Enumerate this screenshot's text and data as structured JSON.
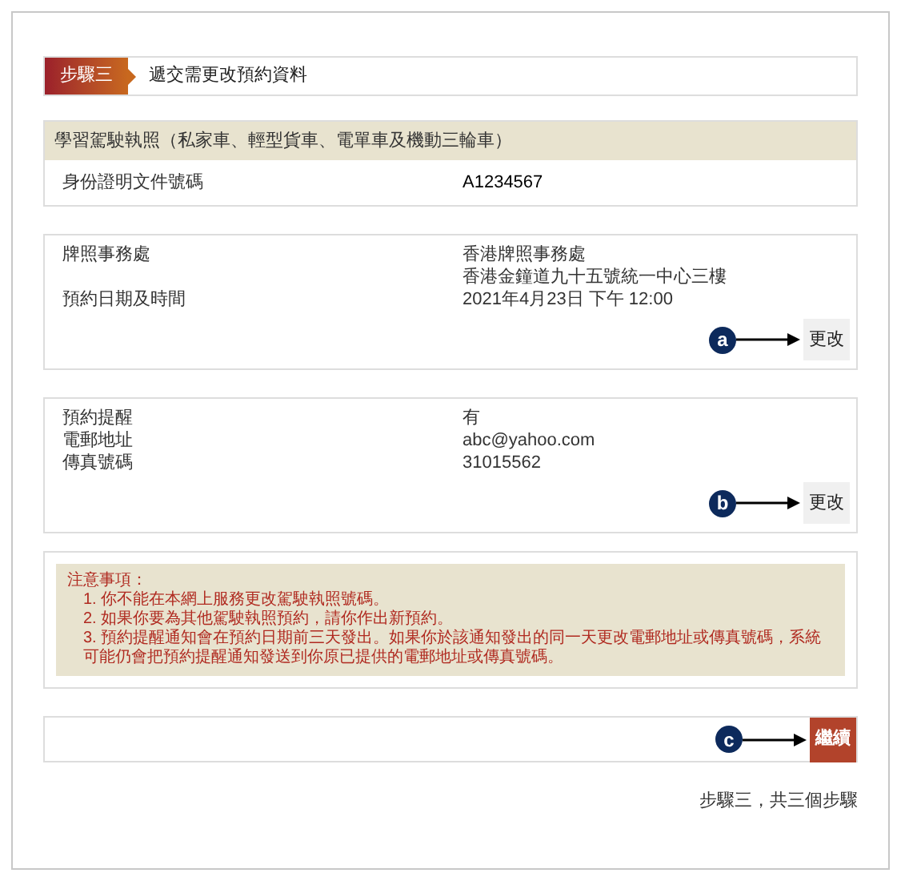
{
  "step_header": {
    "badge": "步驟三",
    "title": "遞交需更改預約資料"
  },
  "licence_section": {
    "heading": "學習駕駛執照（私家車、輕型貨車、電單車及機動三輪車）",
    "rows": [
      {
        "label": "身份證明文件號碼",
        "value": "A1234567"
      }
    ]
  },
  "sections": [
    {
      "rows": [
        {
          "label": "牌照事務處",
          "value": "香港牌照事務處"
        },
        {
          "label": "",
          "value": "香港金鐘道九十五號統一中心三樓"
        },
        {
          "label": "預約日期及時間",
          "value": "2021年4月23日 下午 12:00"
        }
      ],
      "button": "更改",
      "callout": "a"
    },
    {
      "rows": [
        {
          "label": "預約提醒",
          "value": "有"
        },
        {
          "label": "電郵地址",
          "value": "abc@yahoo.com"
        },
        {
          "label": "傳真號碼",
          "value": "31015562"
        }
      ],
      "button": "更改",
      "callout": "b"
    }
  ],
  "notes": {
    "title": "注意事項：",
    "items": [
      "1. 你不能在本網上服務更改駕駛執照號碼。",
      "2. 如果你要為其他駕駛執照預約，請你作出新預約。",
      "3. 預約提醒通知會在預約日期前三天發出。如果你於該通知發出的同一天更改電郵地址或傳真號碼，系統可能仍會把預約提醒通知發送到你原已提供的電郵地址或傳真號碼。"
    ]
  },
  "continue": {
    "button": "繼續",
    "callout": "c"
  },
  "footer": "步驟三，共三個步驟"
}
